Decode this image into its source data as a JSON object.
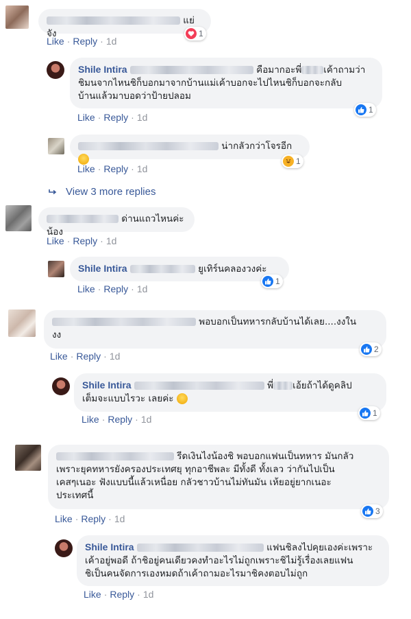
{
  "labels": {
    "like": "Like",
    "reply": "Reply",
    "dot": "·"
  },
  "comments": [
    {
      "text": "แย่จัง",
      "time": "1d",
      "reaction_count": "1"
    },
    {
      "author": "Shile Intira",
      "line1": "คือมากอะพี่",
      "line1b": "เค้าถามว่า",
      "line2": "ชิมนจากไหนชิก็บอกมาจากบ้านแม่เค้าบอกจะไปไหนชิก็บอกจะกลับ",
      "line3": "บ้านแล้วมาบอดว่าป้ายปลอม",
      "time": "1d",
      "reaction_count": "1"
    },
    {
      "text": "น่ากลัวกว่าโจรอีก",
      "time": "1d",
      "reaction_count": "1"
    },
    {
      "text": "ด่านแถวไหนค่ะน้อง",
      "time": "1d"
    },
    {
      "author": "Shile Intira",
      "text": "ยูเทิร์นคลองวงค่ะ",
      "time": "1d",
      "reaction_count": "1"
    },
    {
      "line1": "พอบอกเป็นทหารกลับบ้านได้เลย....งงใน",
      "line2": "งง",
      "time": "1d",
      "reaction_count": "2"
    },
    {
      "author": "Shile Intira",
      "line1a": "พี่",
      "line1b": "เอ้ยถ้าได้ดูคลิป",
      "line2": "เต็มจะแบบไรวะ เลยค่ะ",
      "time": "1d",
      "reaction_count": "1"
    },
    {
      "line1": "รีดเงินไงน้องชิ พอบอกแฟนเป็นทหาร มันกลัว",
      "line2": "เพราะยุคทหารยังครองประเทศยุ ทุกอาชีพละ มีทั้งดี ทั้งเลว ว่ากันไปเป็น",
      "line3": "เคสๆเนอะ ฟังแบบนี้แล้วเหนื่อย กลัวชาวบ้านไม่ทันมัน เห้ยอยู่ยากเนอะ",
      "line4": "ประเทศนี้",
      "time": "1d",
      "reaction_count": "3"
    },
    {
      "author": "Shile Intira",
      "line1": "แฟนชิลงไปคุยเองค่ะเพราะ",
      "line2": "เค้าอยู่พอดี ถ้าชิอยู่คนเดียวคงทำอะไรไม่ถูกเพราะชิไม่รู้เรื่องเลยแฟน",
      "line3": "ชิเป็นคนจัดการเองหมดถ้าเค้าถามอะไรมาชิคงตอบไม่ถูก",
      "time": "1d"
    }
  ],
  "view_more": "View 3 more replies"
}
